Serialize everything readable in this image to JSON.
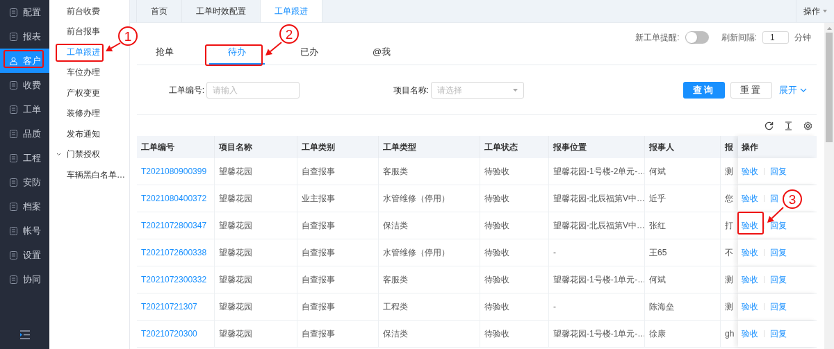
{
  "sidebar": {
    "items": [
      {
        "label": "配置",
        "selected": false
      },
      {
        "label": "报表",
        "selected": false
      },
      {
        "label": "客户",
        "selected": true
      },
      {
        "label": "收费",
        "selected": false
      },
      {
        "label": "工单",
        "selected": false
      },
      {
        "label": "品质",
        "selected": false
      },
      {
        "label": "工程",
        "selected": false
      },
      {
        "label": "安防",
        "selected": false
      },
      {
        "label": "档案",
        "selected": false
      },
      {
        "label": "帐号",
        "selected": false
      },
      {
        "label": "设置",
        "selected": false
      },
      {
        "label": "协同",
        "selected": false
      }
    ]
  },
  "submenu": {
    "items": [
      {
        "label": "前台收费",
        "selected": false,
        "kind": "item"
      },
      {
        "label": "前台报事",
        "selected": false,
        "kind": "item"
      },
      {
        "label": "工单跟进",
        "selected": true,
        "kind": "item"
      },
      {
        "label": "车位办理",
        "selected": false,
        "kind": "item"
      },
      {
        "label": "产权变更",
        "selected": false,
        "kind": "item"
      },
      {
        "label": "装修办理",
        "selected": false,
        "kind": "item"
      },
      {
        "label": "发布通知",
        "selected": false,
        "kind": "item"
      },
      {
        "label": "门禁授权",
        "selected": false,
        "kind": "group"
      },
      {
        "label": "车辆黑白名单…",
        "selected": false,
        "kind": "item"
      }
    ]
  },
  "tabs": [
    {
      "label": "首页",
      "selected": false
    },
    {
      "label": "工单时效配置",
      "selected": false
    },
    {
      "label": "工单跟进",
      "selected": true
    }
  ],
  "tab_actions": "操作",
  "subtabs": [
    {
      "label": "抢单",
      "selected": false
    },
    {
      "label": "待办",
      "selected": true
    },
    {
      "label": "已办",
      "selected": false
    },
    {
      "label": "@我",
      "selected": false
    }
  ],
  "reminder": {
    "label": "新工单提醒:",
    "on": false
  },
  "refresh": {
    "label": "刷新间隔:",
    "value": "1",
    "unit": "分钟"
  },
  "filters": [
    {
      "label": "工单编号:",
      "placeholder": "请输入",
      "kind": "input"
    },
    {
      "label": "项目名称:",
      "placeholder": "请选择",
      "kind": "select"
    }
  ],
  "buttons": {
    "search": "查询",
    "reset": "重置",
    "expand": "展开"
  },
  "table": {
    "columns": [
      "工单编号",
      "项目名称",
      "工单类别",
      "工单类型",
      "工单状态",
      "报事位置",
      "报事人",
      "报",
      "操作"
    ],
    "rows": [
      {
        "cells": [
          "T2021080900399",
          "望馨花园",
          "自查报事",
          "客服类",
          "待验收",
          "望馨花园-1号楼-2单元-…",
          "何斌",
          "测"
        ],
        "actions": [
          "验收",
          "回复"
        ]
      },
      {
        "cells": [
          "T2021080400372",
          "望馨花园",
          "业主报事",
          "水管维修（停用）",
          "待验收",
          "望馨花园-北辰福第V中…",
          "近乎",
          "您"
        ],
        "actions": [
          "验收",
          "回"
        ]
      },
      {
        "cells": [
          "T2021072800347",
          "望馨花园",
          "自查报事",
          "保洁类",
          "待验收",
          "望馨花园-北辰福第V中…",
          "张红",
          "打"
        ],
        "actions": [
          "验收",
          "回复"
        ]
      },
      {
        "cells": [
          "T2021072600338",
          "望馨花园",
          "自查报事",
          "水管维修（停用）",
          "待验收",
          "-",
          "王65",
          "不"
        ],
        "actions": [
          "验收",
          "回复"
        ]
      },
      {
        "cells": [
          "T2021072300332",
          "望馨花园",
          "自查报事",
          "客服类",
          "待验收",
          "望馨花园-1号楼-1单元-…",
          "何斌",
          "测"
        ],
        "actions": [
          "验收",
          "回复"
        ]
      },
      {
        "cells": [
          "T20210721307",
          "望馨花园",
          "自查报事",
          "工程类",
          "待验收",
          "-",
          "陈海垒",
          "测"
        ],
        "actions": [
          "验收",
          "回复"
        ]
      },
      {
        "cells": [
          "T20210720300",
          "望馨花园",
          "自查报事",
          "保洁类",
          "待验收",
          "望馨花园-1号楼-1单元-…",
          "徐康",
          "gh"
        ],
        "actions": [
          "验收",
          "回复"
        ]
      }
    ]
  },
  "annotations": [
    {
      "label": "1"
    },
    {
      "label": "2"
    },
    {
      "label": "3"
    }
  ]
}
